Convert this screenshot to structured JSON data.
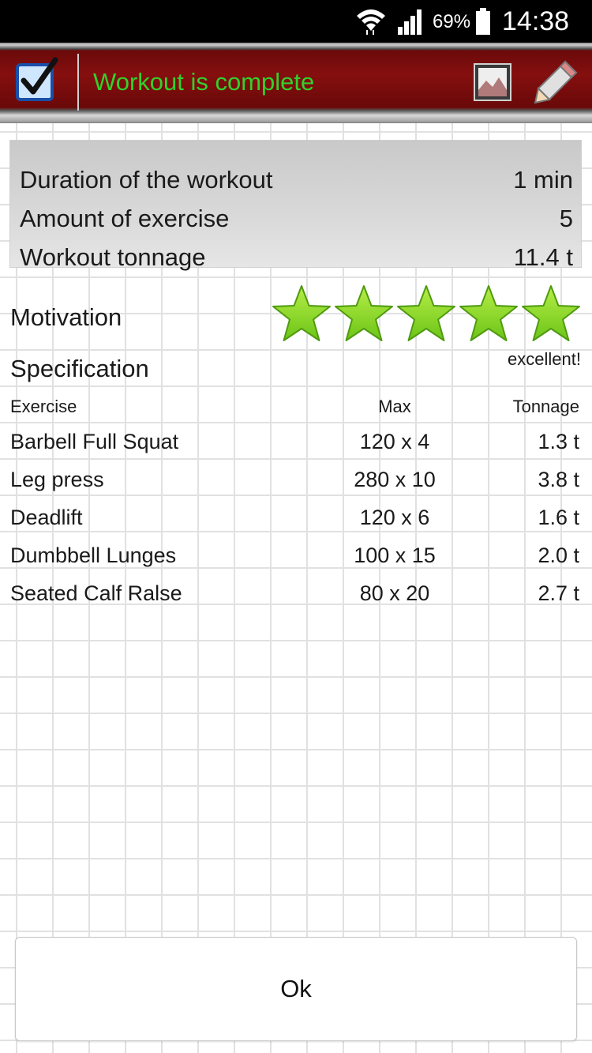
{
  "status_bar": {
    "battery_percent": "69%",
    "time": "14:38",
    "icons": [
      "wifi-icon",
      "signal-icon",
      "battery-icon"
    ]
  },
  "action_bar": {
    "title": "Workout is complete",
    "title_color": "#33d12c",
    "icons": [
      "checkbox-icon",
      "image-icon",
      "pencil-icon"
    ]
  },
  "summary": {
    "rows": [
      {
        "label": "Duration of the workout",
        "value": "1 min"
      },
      {
        "label": "Amount of exercise",
        "value": "5"
      },
      {
        "label": "Workout tonnage",
        "value": "11.4 t"
      }
    ]
  },
  "motivation": {
    "label": "Motivation",
    "stars": 5,
    "max_stars": 5,
    "star_color": "#6cc417",
    "rating_text": "excellent!"
  },
  "specification": {
    "title": "Specification",
    "columns": [
      "Exercise",
      "Max",
      "Tonnage"
    ],
    "rows": [
      {
        "exercise": "Barbell Full Squat",
        "max": "120 x 4",
        "tonnage": "1.3 t"
      },
      {
        "exercise": "Leg press",
        "max": "280 x 10",
        "tonnage": "3.8 t"
      },
      {
        "exercise": "Deadlift",
        "max": "120 x 6",
        "tonnage": "1.6 t"
      },
      {
        "exercise": "Dumbbell Lunges",
        "max": "100 x 15",
        "tonnage": "2.0 t"
      },
      {
        "exercise": "Seated Calf Ralse",
        "max": "80 x 20",
        "tonnage": "2.7 t"
      }
    ]
  },
  "ok_button": {
    "label": "Ok"
  }
}
